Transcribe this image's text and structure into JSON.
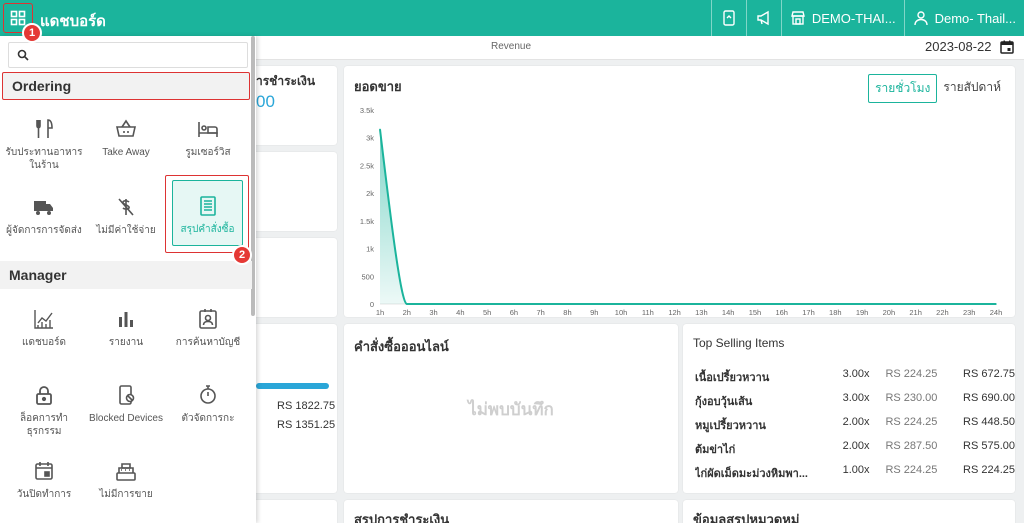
{
  "header": {
    "title": "แดชบอร์ด",
    "store": "DEMO-THAI...",
    "user": "Demo- Thail..."
  },
  "subheader": {
    "revenue_label": "Revenue",
    "date": "2023-08-22"
  },
  "badges": {
    "one": "1",
    "two": "2"
  },
  "menu": {
    "search_placeholder": "",
    "sections": {
      "ordering": "Ordering",
      "manager": "Manager"
    },
    "ordering_items": {
      "dine_in": "รับประทานอาหารในร้าน",
      "take_away": "Take Away",
      "room_service": "รูมเซอร์วิส",
      "delivery": "ผู้จัดการการจัดส่ง",
      "no_charge": "ไม่มีค่าใช้จ่าย",
      "order_summary": "สรุปคำสั่งซื้อ"
    },
    "manager_items": {
      "dashboard": "แดชบอร์ด",
      "report": "รายงาน",
      "account_search": "การค้นหาบัญชี",
      "lock_transactions": "ล็อคการทำธุรกรรม",
      "blocked_devices": "Blocked Devices",
      "scheduler": "ตัวจัดการกะ",
      "close_day": "วันปิดทำการ",
      "no_sale": "ไม่มีการขาย"
    }
  },
  "cards": {
    "payment_partial_title": "ารชำระเงิน",
    "payment_partial_value": "00",
    "sales_title": "ยอดขาย",
    "tab_hourly": "รายชั่วโมง",
    "tab_weekly": "รายสัปดาห์",
    "online_orders_title": "คำสั่งซื้อออนไลน์",
    "no_records": "ไม่พบบันทึก",
    "top_selling_title": "Top Selling Items",
    "amount_1": "RS 1822.75",
    "amount_2": "RS 1351.25",
    "payment_summary_title": "สรุปการชำระเงิน",
    "category_summary_title": "ข้อมูลสรุปหมวดหมู่"
  },
  "top_selling": [
    {
      "name": "เนื้อเปรี้ยวหวาน",
      "qty": "3.00x",
      "price": "RS 224.25",
      "total": "RS 672.75"
    },
    {
      "name": "กุ้งอบวุ้นเส้น",
      "qty": "3.00x",
      "price": "RS 230.00",
      "total": "RS 690.00"
    },
    {
      "name": "หมูเปรี้ยวหวาน",
      "qty": "2.00x",
      "price": "RS 224.25",
      "total": "RS 448.50"
    },
    {
      "name": "ต้มข่าไก่",
      "qty": "2.00x",
      "price": "RS 287.50",
      "total": "RS 575.00"
    },
    {
      "name": "ไก่ผัดเม็ดมะม่วงหิมพา...",
      "qty": "1.00x",
      "price": "RS 224.25",
      "total": "RS 224.25"
    }
  ],
  "chart_data": {
    "type": "area",
    "x": [
      "1h",
      "2h",
      "3h",
      "4h",
      "5h",
      "6h",
      "7h",
      "8h",
      "9h",
      "10h",
      "11h",
      "12h",
      "13h",
      "14h",
      "15h",
      "16h",
      "17h",
      "18h",
      "19h",
      "20h",
      "21h",
      "22h",
      "23h",
      "24h"
    ],
    "series": [
      {
        "values": [
          3150,
          0,
          0,
          0,
          0,
          0,
          0,
          0,
          0,
          0,
          0,
          0,
          0,
          0,
          0,
          0,
          0,
          0,
          0,
          0,
          0,
          0,
          0,
          0
        ]
      }
    ],
    "y_ticks": [
      "0",
      "500",
      "1k",
      "1.5k",
      "2k",
      "2.5k",
      "3k",
      "3.5k"
    ],
    "ylim": [
      0,
      3500
    ],
    "color": "#1bb49c",
    "grid": false
  }
}
